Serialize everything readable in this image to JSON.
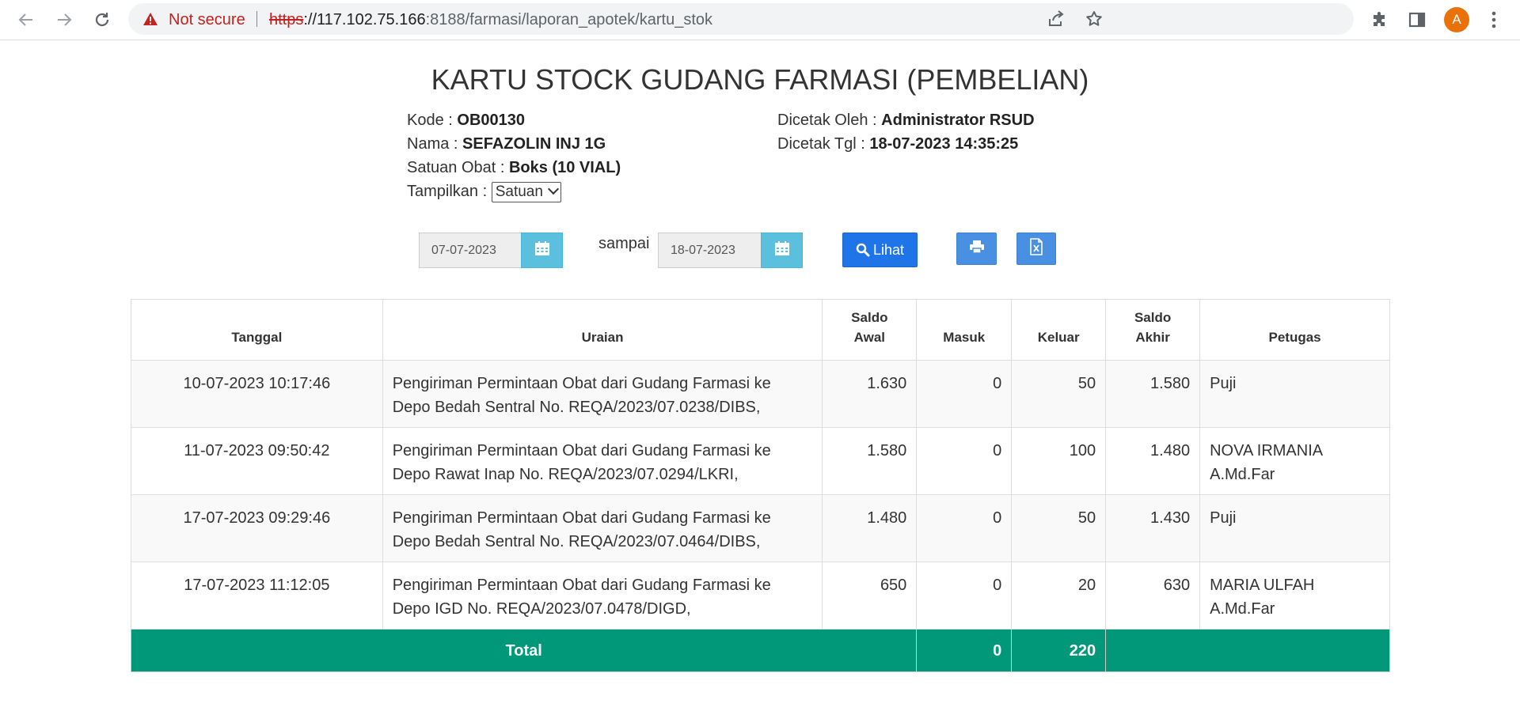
{
  "browser": {
    "not_secure": "Not secure",
    "url_scheme": "https",
    "url_rest_host": "://117.102.75.166",
    "url_rest_path": ":8188/farmasi/laporan_apotek/kartu_stok",
    "avatar_letter": "A"
  },
  "report": {
    "title": "KARTU STOCK GUDANG FARMASI (PEMBELIAN)",
    "kode_label": "Kode : ",
    "kode_value": "OB00130",
    "nama_label": "Nama : ",
    "nama_value": "SEFAZOLIN INJ 1G",
    "satuan_label": "Satuan Obat : ",
    "satuan_value": "Boks (10 VIAL)",
    "tampilkan_label": "Tampilkan : ",
    "tampilkan_value": "Satuan",
    "dicetak_oleh_label": "Dicetak Oleh : ",
    "dicetak_oleh_value": "Administrator RSUD",
    "dicetak_tgl_label": "Dicetak Tgl : ",
    "dicetak_tgl_value": "18-07-2023 14:35:25"
  },
  "filter": {
    "date_from": "07-07-2023",
    "sampai": "sampai",
    "date_to": "18-07-2023",
    "lihat": "Lihat"
  },
  "table": {
    "headers": [
      "Tanggal",
      "Uraian",
      "Saldo Awal",
      "Masuk",
      "Keluar",
      "Saldo Akhir",
      "Petugas"
    ],
    "rows": [
      {
        "tanggal": "10-07-2023 10:17:46",
        "uraian": "Pengiriman Permintaan Obat dari Gudang Farmasi ke Depo Bedah Sentral No. REQA/2023/07.0238/DIBS,",
        "saldo_awal": "1.630",
        "masuk": "0",
        "keluar": "50",
        "saldo_akhir": "1.580",
        "petugas": "Puji"
      },
      {
        "tanggal": "11-07-2023 09:50:42",
        "uraian": "Pengiriman Permintaan Obat dari Gudang Farmasi ke Depo Rawat Inap No. REQA/2023/07.0294/LKRI,",
        "saldo_awal": "1.580",
        "masuk": "0",
        "keluar": "100",
        "saldo_akhir": "1.480",
        "petugas": "NOVA IRMANIA A.Md.Far"
      },
      {
        "tanggal": "17-07-2023 09:29:46",
        "uraian": "Pengiriman Permintaan Obat dari Gudang Farmasi ke Depo Bedah Sentral No. REQA/2023/07.0464/DIBS,",
        "saldo_awal": "1.480",
        "masuk": "0",
        "keluar": "50",
        "saldo_akhir": "1.430",
        "petugas": "Puji"
      },
      {
        "tanggal": "17-07-2023 11:12:05",
        "uraian": "Pengiriman Permintaan Obat dari Gudang Farmasi ke Depo IGD No. REQA/2023/07.0478/DIGD,",
        "saldo_awal": "650",
        "masuk": "0",
        "keluar": "20",
        "saldo_akhir": "630",
        "petugas": "MARIA ULFAH A.Md.Far"
      }
    ],
    "total_label": "Total",
    "total_masuk": "0",
    "total_keluar": "220"
  },
  "colors": {
    "total_bg": "#009879",
    "calendar_btn": "#5bc0de",
    "primary_btn": "#1f75e8",
    "not_secure_red": "#c5221f"
  }
}
